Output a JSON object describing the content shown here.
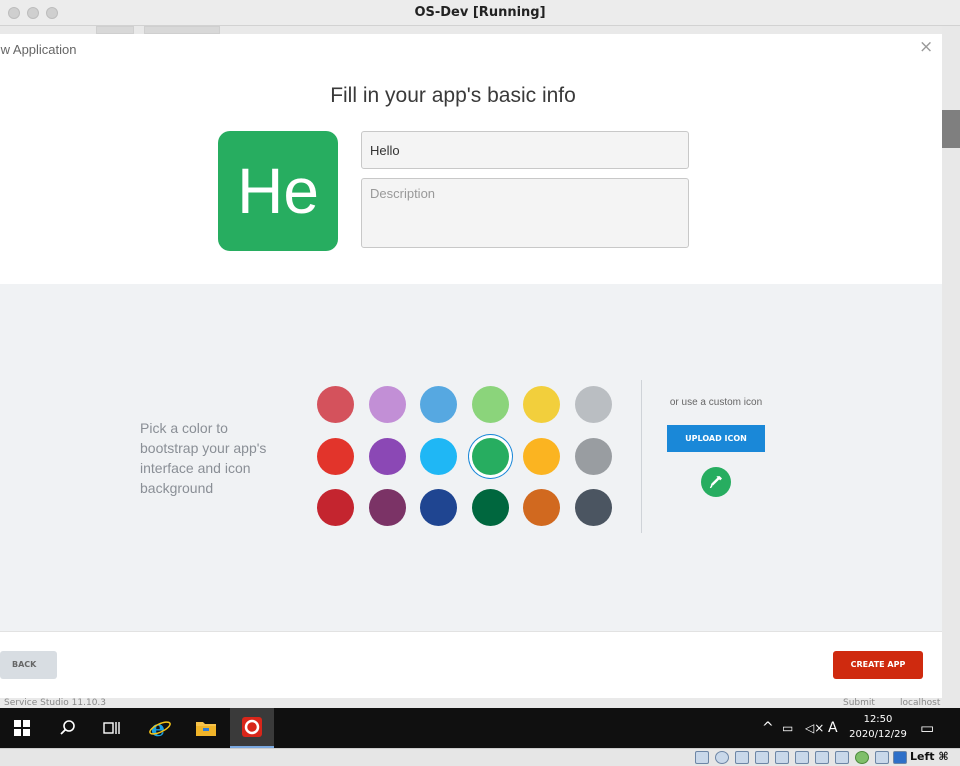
{
  "window": {
    "title": "OS-Dev [Running]"
  },
  "modal": {
    "title": "New Application",
    "close": "×",
    "heading": "Fill in your app's basic info",
    "icon_text": "He",
    "icon_color": "#27ad60",
    "name_value": "Hello",
    "description_placeholder": "Description"
  },
  "color_picker": {
    "prompt": "Pick a color to bootstrap your app's interface and icon background",
    "swatches": [
      "#d4525c",
      "#c28fd6",
      "#56a8e1",
      "#8bd47b",
      "#f2cf3c",
      "#babec2",
      "#e2342b",
      "#8b48b5",
      "#1fb7f5",
      "#27ad60",
      "#fbb421",
      "#999da1",
      "#c4252f",
      "#7b3366",
      "#1f4591",
      "#00673e",
      "#d1691f",
      "#4b5561"
    ],
    "selected_index": 9,
    "custom_text": "or use a custom icon",
    "upload_label": "UPLOAD ICON"
  },
  "footer": {
    "back_label": "BACK",
    "create_label": "CREATE APP"
  },
  "background": {
    "status_text": "Service Studio 11.10.3",
    "status_right_1": "Submit",
    "status_right_2": "localhost"
  },
  "taskbar": {
    "time": "12:50",
    "date": "2020/12/29",
    "ime": "A"
  },
  "vbox": {
    "host_key": "Left ⌘"
  }
}
